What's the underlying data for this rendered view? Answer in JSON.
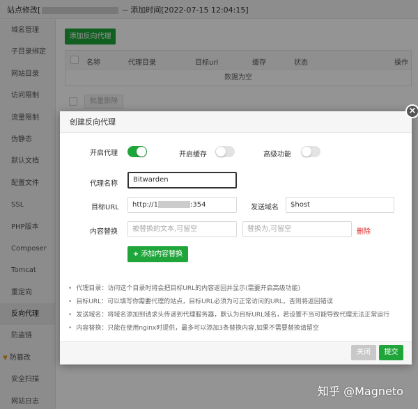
{
  "background": {
    "title_prefix": "站点修改[",
    "title_suffix": " -- 添加时间[2022-07-15 12:04:15]",
    "sidebar": [
      {
        "label": "域名管理"
      },
      {
        "label": "子目录绑定"
      },
      {
        "label": "网站目录"
      },
      {
        "label": "访问限制"
      },
      {
        "label": "流量限制"
      },
      {
        "label": "伪静态"
      },
      {
        "label": "默认文档"
      },
      {
        "label": "配置文件"
      },
      {
        "label": "SSL"
      },
      {
        "label": "PHP版本"
      },
      {
        "label": "Composer"
      },
      {
        "label": "Tomcat"
      },
      {
        "label": "重定向"
      },
      {
        "label": "反向代理"
      },
      {
        "label": "防盗链"
      },
      {
        "label": "防篡改"
      },
      {
        "label": "安全扫描"
      },
      {
        "label": "网站日志"
      }
    ],
    "add_proxy_button": "添加反向代理",
    "table": {
      "columns": [
        "名称",
        "代理目录",
        "目标url",
        "缓存",
        "状态",
        "操作"
      ],
      "empty_text": "数据为空"
    },
    "batch_delete_button": "批量删除"
  },
  "modal": {
    "title": "创建反向代理",
    "enable_proxy_label": "开启代理",
    "enable_proxy": true,
    "enable_cache_label": "开启缓存",
    "enable_cache": false,
    "advanced_label": "高级功能",
    "advanced": false,
    "proxy_name_label": "代理名称",
    "proxy_name_value": "Bitwarden",
    "target_url_label": "目标URL",
    "target_url_prefix": "http://1",
    "target_url_suffix": ":354",
    "send_domain_label": "发送域名",
    "send_domain_value": "$host",
    "content_replace_label": "内容替换",
    "replace_from_placeholder": "被替换的文本,可留空",
    "replace_to_placeholder": "替换为,可留空",
    "delete_link": "删除",
    "add_replace_button": "添加内容替换",
    "tips": [
      "代理目录：访问这个目录时将会把目标URL的内容返回并显示(需要开启高级功能)",
      "目标URL：可以填写你需要代理的站点，目标URL必须为可正常访问的URL，否则将返回错误",
      "发送域名：将域名添加到请求头传递到代理服务器，默认为目标URL域名，若设置不当可能导致代理无法正常运行",
      "内容替换：只能在使用nginx时提供，最多可以添加3条替换内容,如果不需要替换请留空"
    ],
    "close_button": "关闭",
    "submit_button": "提交"
  },
  "watermark": "知乎 @Magneto",
  "colors": {
    "accent": "#20a53a",
    "danger": "#e02020"
  }
}
